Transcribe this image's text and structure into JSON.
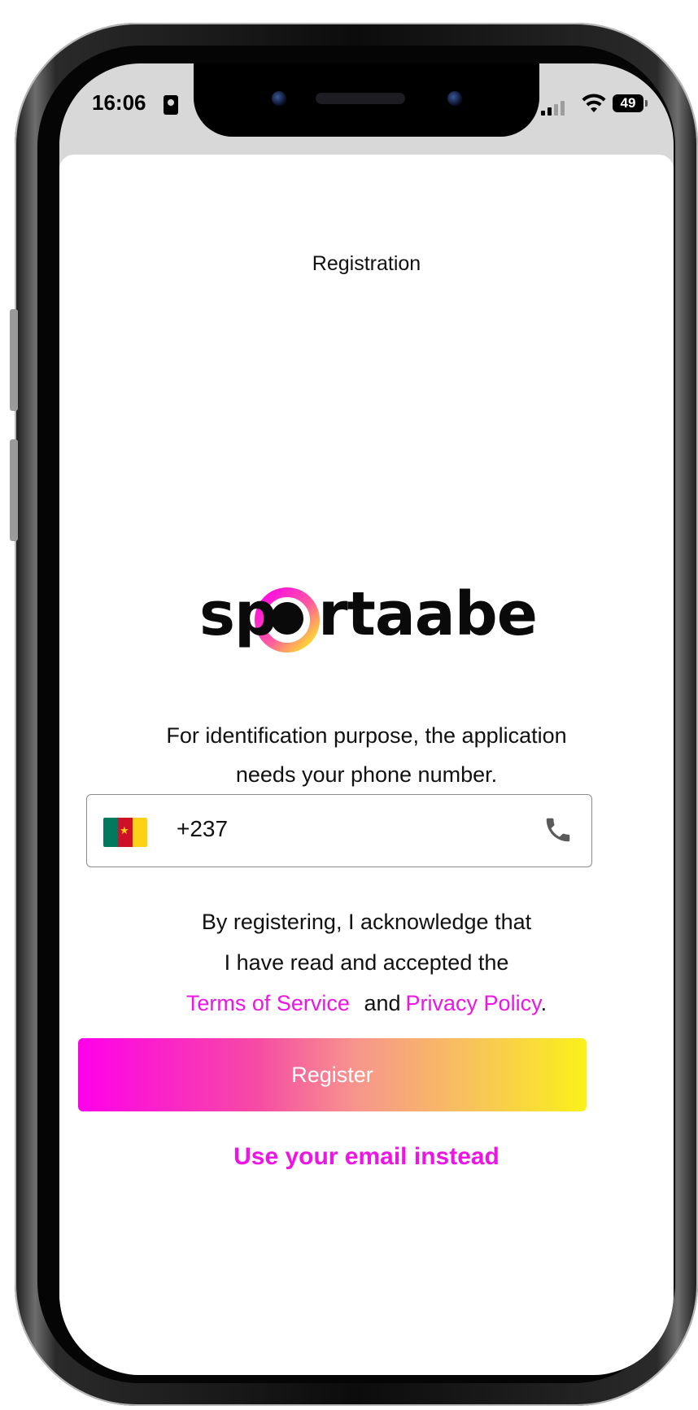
{
  "status_bar": {
    "time": "16:06",
    "battery": "49"
  },
  "header": {
    "title": "Registration"
  },
  "brand": {
    "logo_text_left": "sp",
    "logo_text_right": "rtaabe",
    "colors": {
      "magenta": "#ff00ea",
      "yellow": "#fbf11a"
    }
  },
  "intro": {
    "line1": "For identification purpose, the application",
    "line2": "needs your phone number."
  },
  "phone_input": {
    "country_flag": "cameroon-flag",
    "dial_code": "+237",
    "icon": "phone-icon"
  },
  "legal": {
    "line1": "By registering, I acknowledge that",
    "line2": "I have read and accepted the",
    "terms_label": "Terms of Service",
    "and_text": "and",
    "privacy_label": "Privacy Policy",
    "period": "."
  },
  "actions": {
    "register_label": "Register",
    "email_link_label": "Use your email instead"
  }
}
